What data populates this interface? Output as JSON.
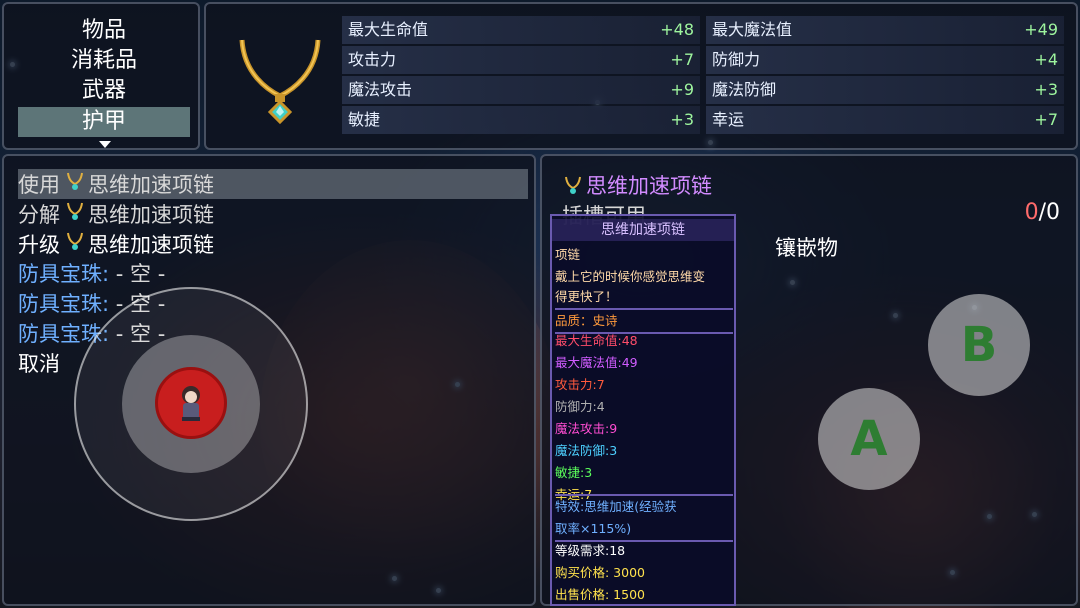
{
  "categories": {
    "items": [
      "物品",
      "消耗品",
      "武器",
      "护甲"
    ],
    "selected": "护甲"
  },
  "item": {
    "name": "思维加速项链",
    "icon": "necklace-icon"
  },
  "stats": [
    {
      "label": "最大生命值",
      "value": "+48"
    },
    {
      "label": "最大魔法值",
      "value": "+49"
    },
    {
      "label": "攻击力",
      "value": "+7"
    },
    {
      "label": "防御力",
      "value": "+4"
    },
    {
      "label": "魔法攻击",
      "value": "+9"
    },
    {
      "label": "魔法防御",
      "value": "+3"
    },
    {
      "label": "敏捷",
      "value": "+3"
    },
    {
      "label": "幸运",
      "value": "+7"
    }
  ],
  "actions": [
    {
      "verb": "使用",
      "target": "思维加速项链"
    },
    {
      "verb": "分解",
      "target": "思维加速项链"
    },
    {
      "verb": "升级",
      "target": "思维加速项链"
    },
    {
      "verb": "防具宝珠:",
      "target": "- 空 -"
    },
    {
      "verb": "防具宝珠:",
      "target": "- 空 -"
    },
    {
      "verb": "防具宝珠:",
      "target": "- 空 -"
    },
    {
      "verb": "取消",
      "target": ""
    }
  ],
  "detail": {
    "title": "思维加速项链",
    "slot_label": "插槽可用",
    "slot_used": "0",
    "slot_sep": "/",
    "slot_total": "0",
    "inlay_label": "镶嵌物"
  },
  "tooltip": {
    "title": "思维加速项链",
    "type": "项链",
    "desc1": "戴上它的时候你感觉思维变",
    "desc2": "得更快了！",
    "quality": "品质：史诗",
    "stats": [
      {
        "text": "最大生命值:48",
        "color": "#ff4d6a"
      },
      {
        "text": "最大魔法值:49",
        "color": "#d05cff"
      },
      {
        "text": "攻击力:7",
        "color": "#ff5a3c"
      },
      {
        "text": "防御力:4",
        "color": "#b0b0b0"
      },
      {
        "text": "魔法攻击:9",
        "color": "#ff4dd2"
      },
      {
        "text": "魔法防御:3",
        "color": "#4dd0ff"
      },
      {
        "text": "敏捷:3",
        "color": "#5cff5c"
      },
      {
        "text": "幸运:7",
        "color": "#ffe24d"
      }
    ],
    "effect1": "特效:思维加速(经验获",
    "effect2": "取率×115%)",
    "level_req": "等级需求:18",
    "buy_price": "购买价格: 3000",
    "sell_price": "出售价格: 1500"
  },
  "controls": {
    "a_label": "A",
    "b_label": "B"
  },
  "colors": {
    "stat_value": "#9ef59e",
    "item_name": "#d28bff",
    "gem_slot": "#6fb0ff",
    "quality": "#ff9a3c",
    "effect": "#6fb0ff",
    "price": "#ffe24d"
  }
}
